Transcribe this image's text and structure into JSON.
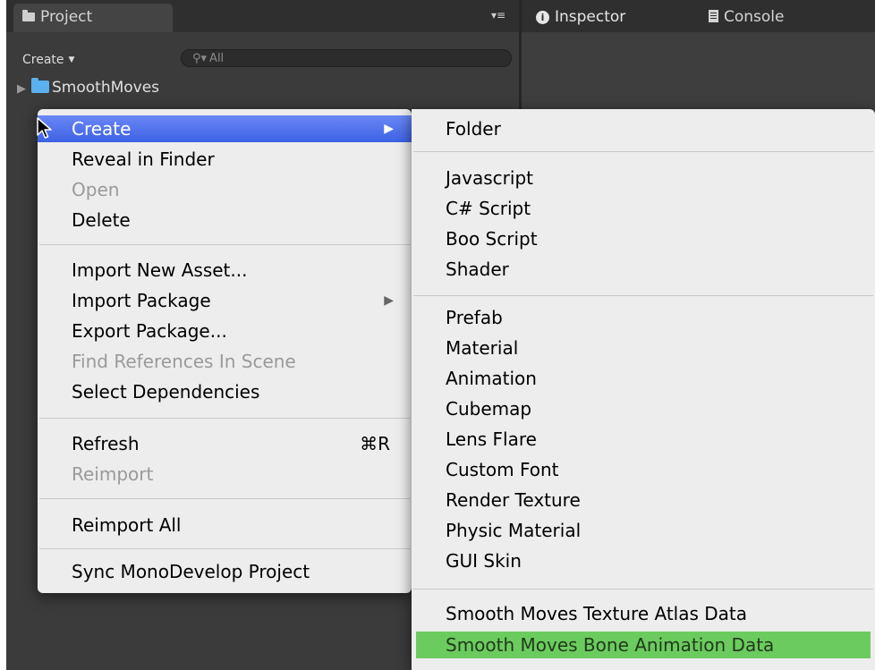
{
  "tabs": {
    "project": "Project",
    "inspector": "Inspector",
    "console": "Console",
    "panel_menu": "▾≡"
  },
  "project_toolbar": {
    "create_label": "Create",
    "search_placeholder": "All"
  },
  "tree": {
    "root_folder": "SmoothMoves"
  },
  "context_menu": {
    "create": "Create",
    "reveal_in_finder": "Reveal in Finder",
    "open": "Open",
    "delete": "Delete",
    "import_new_asset": "Import New Asset...",
    "import_package": "Import Package",
    "export_package": "Export Package...",
    "find_references": "Find References In Scene",
    "select_dependencies": "Select Dependencies",
    "refresh": "Refresh",
    "refresh_shortcut": "⌘R",
    "reimport": "Reimport",
    "reimport_all": "Reimport All",
    "sync_monodevelop": "Sync MonoDevelop Project"
  },
  "create_submenu": {
    "folder": "Folder",
    "javascript": "Javascript",
    "csharp_script": "C# Script",
    "boo_script": "Boo Script",
    "shader": "Shader",
    "prefab": "Prefab",
    "material": "Material",
    "animation": "Animation",
    "cubemap": "Cubemap",
    "lens_flare": "Lens Flare",
    "custom_font": "Custom Font",
    "render_texture": "Render Texture",
    "physic_material": "Physic Material",
    "gui_skin": "GUI Skin",
    "texture_atlas": "Smooth Moves Texture Atlas Data",
    "bone_animation": "Smooth Moves Bone Animation Data"
  },
  "colors": {
    "highlight_blue": "#4b6fe9",
    "highlight_green": "#6ccb5f",
    "editor_dark": "#3b3b3b"
  }
}
